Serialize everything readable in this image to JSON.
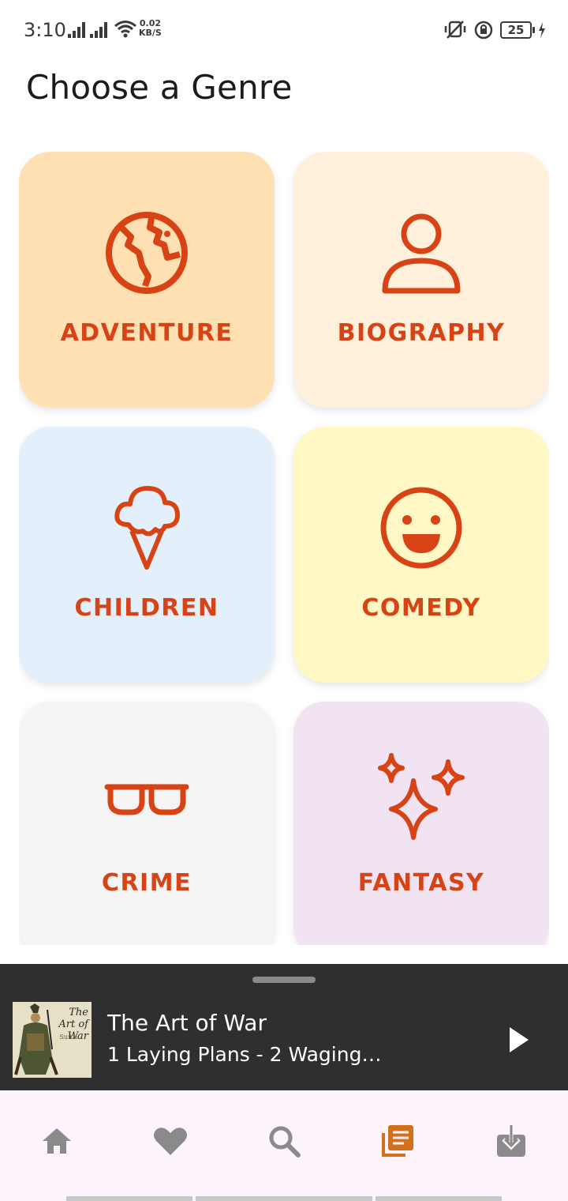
{
  "status_bar": {
    "time": "3:10",
    "net_speed_value": "0.02",
    "net_speed_unit": "KB/S",
    "battery": "25"
  },
  "page": {
    "title": "Choose a Genre"
  },
  "genres": [
    {
      "label": "ADVENTURE",
      "icon": "globe-icon",
      "bg": "#ffe0b2"
    },
    {
      "label": "BIOGRAPHY",
      "icon": "person-icon",
      "bg": "#fff0dc"
    },
    {
      "label": "CHILDREN",
      "icon": "ice-cream-icon",
      "bg": "#e3f0fc"
    },
    {
      "label": "COMEDY",
      "icon": "smiley-icon",
      "bg": "#fff8c4"
    },
    {
      "label": "CRIME",
      "icon": "glasses-icon",
      "bg": "#f4f4f4"
    },
    {
      "label": "FANTASY",
      "icon": "sparkles-icon",
      "bg": "#f2e3f3"
    }
  ],
  "accent_color": "#d84315",
  "mini_player": {
    "cover": {
      "title": "The Art of War",
      "author": "Sunzi"
    },
    "title": "The Art of War",
    "subtitle": "1 Laying Plans - 2 Waging…",
    "play_icon": "play-icon"
  },
  "bottom_nav": [
    {
      "icon": "home-icon",
      "active": false
    },
    {
      "icon": "heart-icon",
      "active": false
    },
    {
      "icon": "search-icon",
      "active": false
    },
    {
      "icon": "library-icon",
      "active": true
    },
    {
      "icon": "download-icon",
      "active": false
    }
  ]
}
